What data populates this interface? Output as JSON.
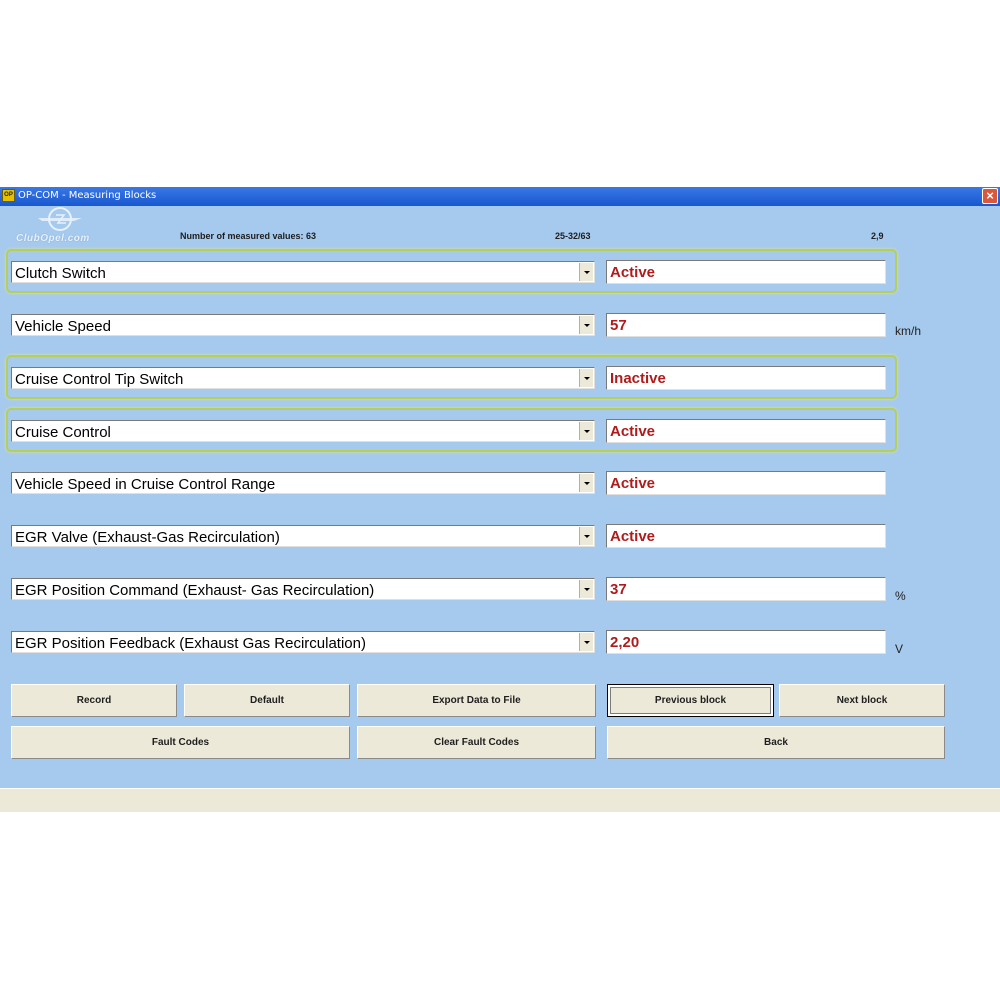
{
  "window": {
    "title": "OP-COM - Measuring Blocks",
    "app_icon": "op-com-icon",
    "close_label": "×"
  },
  "watermark": {
    "text": "ClubOpel.com"
  },
  "header": {
    "measured_label": "Number of measured values: 63",
    "range": "25-32/63",
    "rate": "2,9"
  },
  "rows": [
    {
      "parameter": "Clutch Switch",
      "value": "Active",
      "unit": "",
      "highlighted": true
    },
    {
      "parameter": "Vehicle Speed",
      "value": "57",
      "unit": "km/h",
      "highlighted": false
    },
    {
      "parameter": "Cruise Control Tip Switch",
      "value": "Inactive",
      "unit": "",
      "highlighted": true
    },
    {
      "parameter": "Cruise Control",
      "value": "Active",
      "unit": "",
      "highlighted": true
    },
    {
      "parameter": "Vehicle Speed in Cruise Control Range",
      "value": "Active",
      "unit": "",
      "highlighted": false
    },
    {
      "parameter": "EGR Valve (Exhaust-Gas Recirculation)",
      "value": "Active",
      "unit": "",
      "highlighted": false
    },
    {
      "parameter": "EGR Position Command (Exhaust- Gas Recirculation)",
      "value": "37",
      "unit": "%",
      "highlighted": false
    },
    {
      "parameter": "EGR Position Feedback (Exhaust Gas Recirculation)",
      "value": "2,20",
      "unit": "V",
      "highlighted": false
    }
  ],
  "buttons": {
    "record": "Record",
    "default": "Default",
    "export": "Export Data to File",
    "previous": "Previous block",
    "next": "Next block",
    "fault_codes": "Fault Codes",
    "clear_fault_codes": "Clear Fault Codes",
    "back": "Back"
  },
  "colors": {
    "background": "#a6c9ee",
    "value_text": "#b01c1c",
    "highlight": "#b5cf5a",
    "titlebar": "#1857cf"
  }
}
